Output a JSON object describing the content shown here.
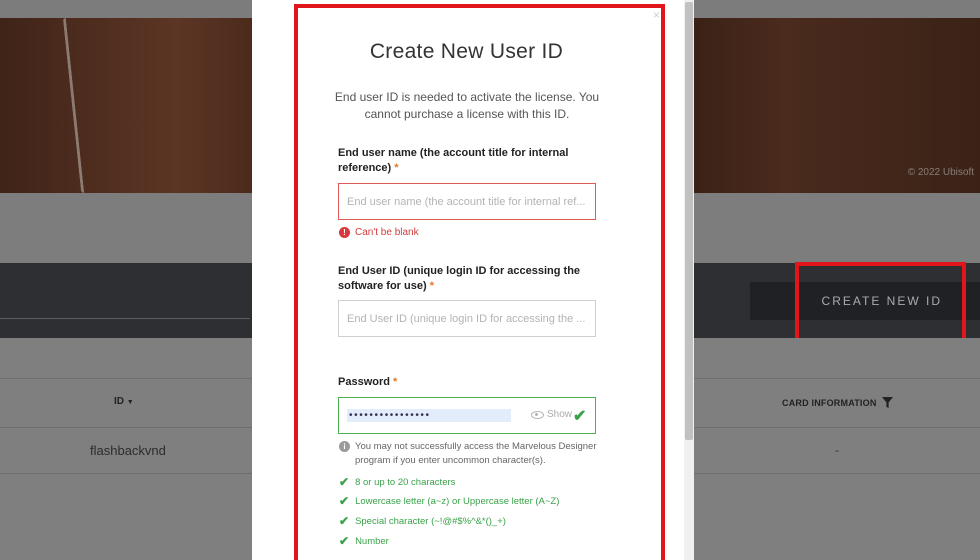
{
  "background": {
    "copyright": "© 2022 Ubisoft",
    "create_button_label": "CREATE NEW ID",
    "table": {
      "headers": {
        "id": "ID",
        "card_information": "CARD INFORMATION"
      },
      "rows": [
        {
          "id": "flashbackvnd",
          "card": "-"
        }
      ]
    }
  },
  "modal": {
    "close_glyph": "×",
    "title": "Create New User ID",
    "subtitle": "End user ID is needed to activate the license. You cannot purchase a license with this ID.",
    "username": {
      "label": "End user name (the account title for internal reference)",
      "required_mark": "*",
      "placeholder": "End user name (the account title for internal ref...",
      "error": "Can't be blank"
    },
    "userid": {
      "label": "End User ID (unique login ID for accessing the software for use)",
      "required_mark": "*",
      "placeholder": "End User ID (unique login ID for accessing the ..."
    },
    "password": {
      "label": "Password",
      "required_mark": "*",
      "masked_value": "••••••••••••••••",
      "show_label": "Show",
      "info": "You may not successfully access the Marvelous Designer program if you enter uncommon character(s).",
      "rules": [
        "8 or up to 20 characters",
        "Lowercase letter (a~z) or Uppercase letter (A~Z)",
        "Special character (~!@#$%^&*()_+)",
        "Number"
      ]
    }
  },
  "colors": {
    "highlight_red": "#e0161b",
    "success_green": "#3aa24a",
    "error_red": "#d03c3c",
    "required_orange": "#e87722"
  }
}
